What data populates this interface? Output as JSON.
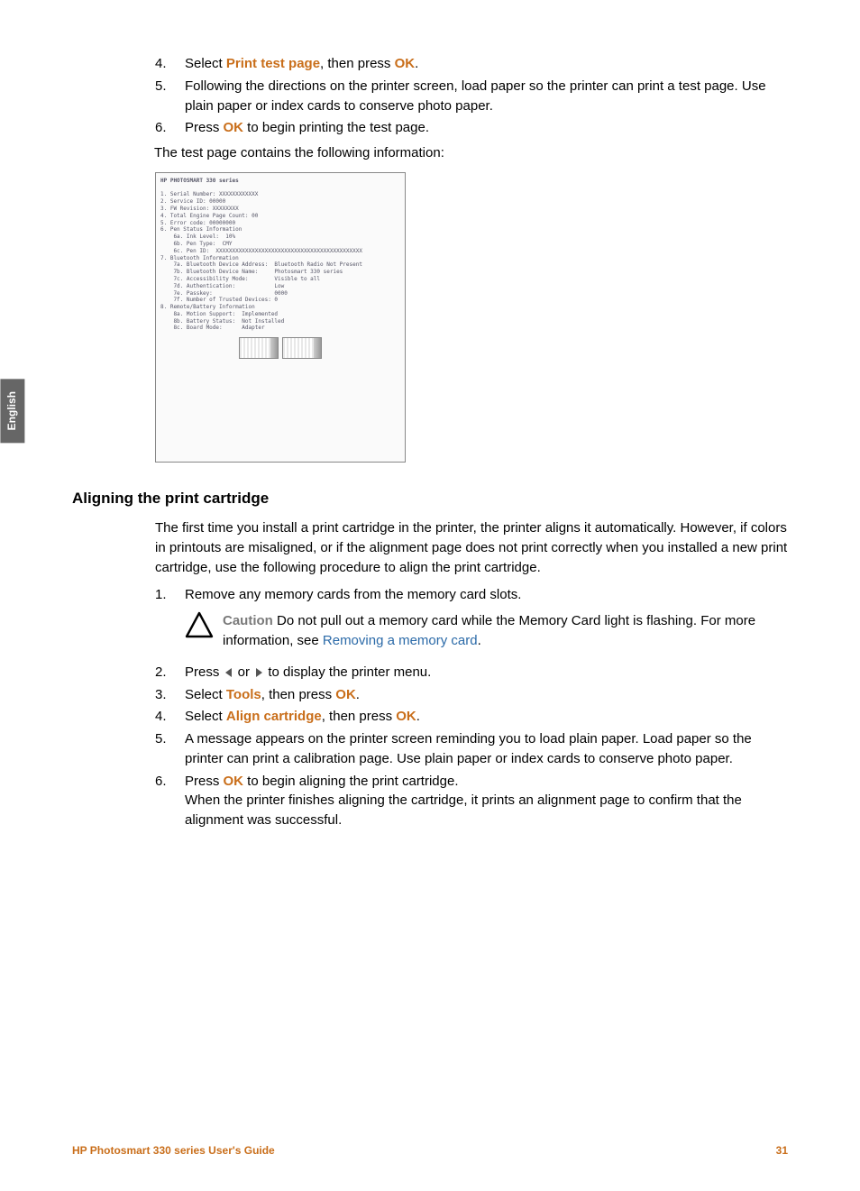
{
  "side_tab": "English",
  "top_steps": {
    "s4": {
      "num": "4.",
      "pre": "Select ",
      "link1": "Print test page",
      "mid": ", then press ",
      "link2": "OK",
      "post": "."
    },
    "s5": {
      "num": "5.",
      "text": "Following the directions on the printer screen, load paper so the printer can print a test page. Use plain paper or index cards to conserve photo paper."
    },
    "s6": {
      "num": "6.",
      "pre": "Press ",
      "link1": "OK",
      "post": " to begin printing the test page."
    }
  },
  "intro": "The test page contains the following information:",
  "testpage": {
    "title": "HP PHOTOSMART 330 series",
    "lines": [
      "1. Serial Number: XXXXXXXXXXXX",
      "2. Service ID: 00000",
      "3. FW Revision: XXXXXXXX",
      "4. Total Engine Page Count: 00",
      "5. Error code: 00000000",
      "6. Pen Status Information",
      "    6a. Ink Level:  10%",
      "    6b. Pen Type:  CMY",
      "    6c. Pen ID:  XXXXXXXXXXXXXXXXXXXXXXXXXXXXXXXXXXXXXXXXXXXXX",
      "7. Bluetooth Information",
      "    7a. Bluetooth Device Address:  Bluetooth Radio Not Present",
      "    7b. Bluetooth Device Name:     Photosmart 330 series",
      "    7c. Accessibility Mode:        Visible to all",
      "    7d. Authentication:            Low",
      "    7e. Passkey:                   0000",
      "    7f. Number of Trusted Devices: 0",
      "8. Remote/Battery Information",
      "    8a. Motion Support:  Implemented",
      "    8b. Battery Status:  Not Installed",
      "    8c. Board Mode:      Adapter"
    ]
  },
  "section_heading": "Aligning the print cartridge",
  "align_intro": "The first time you install a print cartridge in the printer, the printer aligns it automatically. However, if colors in printouts are misaligned, or if the alignment page does not print correctly when you installed a new print cartridge, use the following procedure to align the print cartridge.",
  "align_steps": {
    "s1": {
      "num": "1.",
      "text": "Remove any memory cards from the memory card slots."
    },
    "caution": {
      "label": "Caution",
      "text": "   Do not pull out a memory card while the Memory Card light is flashing. For more information, see ",
      "link": "Removing a memory card",
      "post": "."
    },
    "s2": {
      "num": "2.",
      "pre": "Press ",
      "mid": " or ",
      "post": " to display the printer menu."
    },
    "s3": {
      "num": "3.",
      "pre": "Select ",
      "link1": "Tools",
      "mid": ", then press ",
      "link2": "OK",
      "post": "."
    },
    "s4": {
      "num": "4.",
      "pre": "Select ",
      "link1": "Align cartridge",
      "mid": ", then press ",
      "link2": "OK",
      "post": "."
    },
    "s5": {
      "num": "5.",
      "text": "A message appears on the printer screen reminding you to load plain paper. Load paper so the printer can print a calibration page. Use plain paper or index cards to conserve photo paper."
    },
    "s6": {
      "num": "6.",
      "pre": "Press ",
      "link1": "OK",
      "post": " to begin aligning the print cartridge.",
      "line2": "When the printer finishes aligning the cartridge, it prints an alignment page to confirm that the alignment was successful."
    }
  },
  "footer": {
    "left": "HP Photosmart 330 series User's Guide",
    "right": "31"
  }
}
